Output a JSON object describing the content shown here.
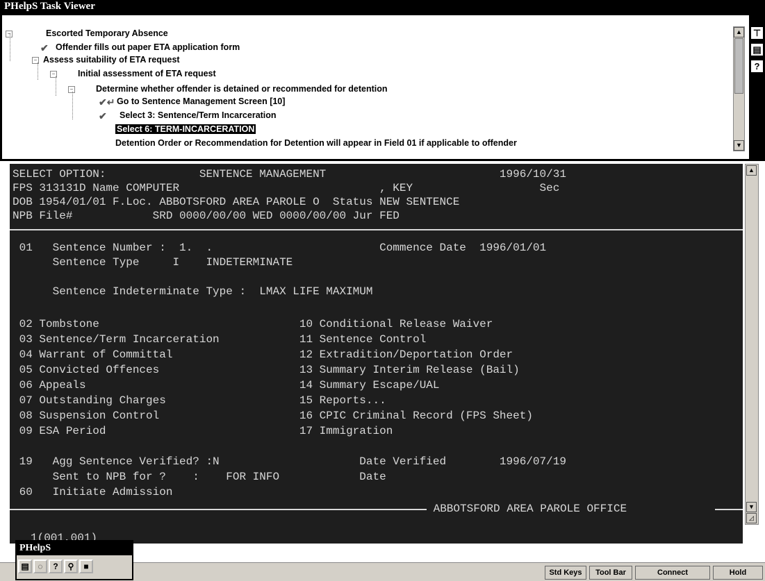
{
  "task_viewer": {
    "title": "PHelpS Task Viewer",
    "tree": [
      {
        "text": "Escorted Temporary Absence",
        "prefix": "minus"
      },
      {
        "text": "Offender fills out paper ETA application form",
        "prefix": "check"
      },
      {
        "text": "Assess suitability of ETA request",
        "prefix": "minus"
      },
      {
        "text": "Initial assessment of ETA request",
        "prefix": "minus"
      },
      {
        "text": "Determine whether offender is detained or recommended for detention",
        "prefix": "minus"
      },
      {
        "text": "Go to Sentence Management Screen [10]",
        "prefix": "check-arrow"
      },
      {
        "text": "Select 3: Sentence/Term Incarceration",
        "prefix": "check"
      },
      {
        "text": "Select 6: TERM-INCARCERATION",
        "prefix": "none",
        "selected": true
      },
      {
        "text": "Detention Order or Recommendation for Detention will appear in Field 01 if applicable to offender",
        "prefix": "none"
      }
    ],
    "side_icons": [
      "tree-icon",
      "save-icon",
      "help-icon"
    ]
  },
  "terminal": {
    "header": [
      "SELECT OPTION:              SENTENCE MANAGEMENT                          1996/10/31",
      "FPS 313131D Name COMPUTER                              , KEY                   Sec",
      "DOB 1954/01/01 F.Loc. ABBOTSFORD AREA PAROLE O  Status NEW SENTENCE",
      "NPB File#            SRD 0000/00/00 WED 0000/00/00 Jur FED"
    ],
    "body": [
      " 01   Sentence Number :  1.  .                         Commence Date  1996/01/01",
      "      Sentence Type     I    INDETERMINATE",
      "",
      "      Sentence Indeterminate Type :  LMAX LIFE MAXIMUM",
      "",
      " 02 Tombstone                              10 Conditional Release Waiver",
      " 03 Sentence/Term Incarceration            11 Sentence Control",
      " 04 Warrant of Committal                   12 Extradition/Deportation Order",
      " 05 Convicted Offences                     13 Summary Interim Release (Bail)",
      " 06 Appeals                                14 Summary Escape/UAL",
      " 07 Outstanding Charges                    15 Reports...",
      " 08 Suspension Control                     16 CPIC Criminal Record (FPS Sheet)",
      " 09 ESA Period                             17 Immigration",
      "",
      " 19   Agg Sentence Verified? :N                     Date Verified        1996/07/19",
      "      Sent to NPB for ?    :    FOR INFO            Date",
      " 60   Initiate Admission"
    ],
    "footer_label": " ABBOTSFORD AREA PAROLE OFFICE ",
    "position": "1(001,001)"
  },
  "mini_window": {
    "title": "PHelpS",
    "buttons": [
      "list-icon",
      "bulb-icon",
      "?",
      "pin-icon",
      "stop-icon"
    ]
  },
  "status_bar": {
    "buttons": [
      "Std Keys",
      "Tool Bar",
      "Connect",
      "Hold"
    ]
  }
}
